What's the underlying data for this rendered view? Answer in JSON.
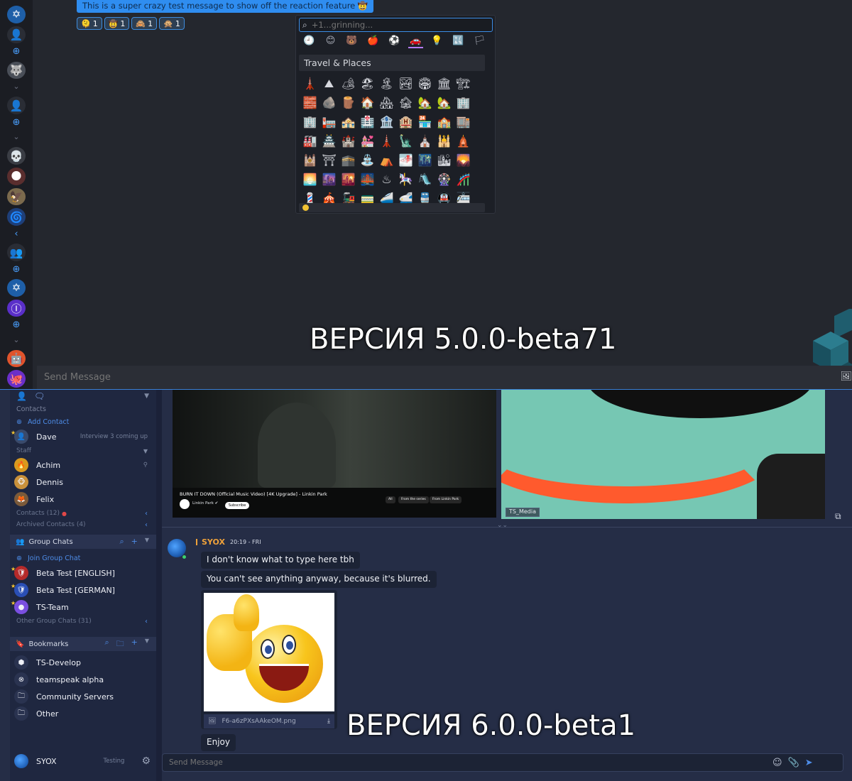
{
  "top": {
    "pinned_message": "This is a super crazy test message to show off the reaction feature 🤠",
    "reactions": [
      {
        "emoji": "🫠",
        "count": "1"
      },
      {
        "emoji": "🤠",
        "count": "1"
      },
      {
        "emoji": "🙈",
        "count": "1"
      },
      {
        "emoji": "🙊",
        "count": "1"
      }
    ],
    "emoji_picker": {
      "search_placeholder": "+1...grinning...",
      "categories": [
        "🕘",
        "😊",
        "🐻",
        "🍎",
        "⚽",
        "🚗",
        "💡",
        "🔣",
        "🏳"
      ],
      "active_category_index": 5,
      "section_title": "Travel & Places",
      "emojis": [
        "🗼",
        "⛰",
        "🏕",
        "🏖",
        "🏝",
        "🏞",
        "🏟",
        "🏛",
        "🏗",
        "🧱",
        "🪨",
        "🪵",
        "🏠",
        "🏘",
        "🏚",
        "🏡",
        "🏡",
        "🏢",
        "🏢",
        "🏣",
        "🏤",
        "🏥",
        "🏦",
        "🏨",
        "🏪",
        "🏫",
        "🏬",
        "🏭",
        "🏯",
        "🏰",
        "💒",
        "🗼",
        "🗽",
        "⛪",
        "🕌",
        "🛕",
        "🕍",
        "⛩",
        "🕋",
        "⛲",
        "⛺",
        "🌁",
        "🌃",
        "🏙",
        "🌄",
        "🌅",
        "🌆",
        "🌇",
        "🌉",
        "♨",
        "🎠",
        "🛝",
        "🎡",
        "🎢",
        "💈",
        "🎪",
        "🚂",
        "🚃",
        "🚄",
        "🚅",
        "🚆",
        "🚇",
        "🚈"
      ]
    },
    "caption": "ВЕРСИЯ 5.0.0-beta71",
    "input_placeholder": "Send Message",
    "rail": [
      {
        "name": "app-logo-icon",
        "glyph": "✡",
        "bg": "#1e5fa8"
      },
      {
        "name": "user-icon",
        "glyph": "👤",
        "bg": "#2a2d35"
      },
      {
        "name": "server-avatar-1",
        "glyph": "🐺",
        "bg": "#4a4f58"
      },
      {
        "name": "user-icon-2",
        "glyph": "👤",
        "bg": "#2a2d35"
      },
      {
        "name": "server-avatar-2",
        "glyph": "💀",
        "bg": "#3a3d44"
      },
      {
        "name": "server-avatar-3",
        "glyph": "🌑",
        "bg": "#5a2e2e"
      },
      {
        "name": "server-avatar-4",
        "glyph": "🦅",
        "bg": "#7b6a4d"
      },
      {
        "name": "server-avatar-5",
        "glyph": "🌀",
        "bg": "#1e3f79"
      },
      {
        "name": "group-icon",
        "glyph": "👥",
        "bg": "#2a2d35"
      },
      {
        "name": "server-avatar-6",
        "glyph": "✡",
        "bg": "#1e5fa8"
      },
      {
        "name": "server-avatar-7",
        "glyph": "Ⓘ",
        "bg": "#5a2fc9"
      },
      {
        "name": "server-avatar-8",
        "glyph": "🤖",
        "bg": "#e0542c"
      },
      {
        "name": "server-avatar-9",
        "glyph": "🐙",
        "bg": "#6b2fc9"
      }
    ]
  },
  "bottom": {
    "sidebar": {
      "contacts_header": "Contacts",
      "add_contact": "Add Contact",
      "contacts": [
        {
          "name": "Dave",
          "status": "Interview 3 coming up",
          "avatar": "👤",
          "bg": "#3a4a6b"
        }
      ],
      "staff_header": "Staff",
      "staff": [
        {
          "name": "Achim",
          "avatar": "🔥",
          "bg": "#d99a1e"
        },
        {
          "name": "Dennis",
          "avatar": "🐵",
          "bg": "#c9913b"
        },
        {
          "name": "Felix",
          "avatar": "🦊",
          "bg": "#7b5a3a"
        }
      ],
      "contacts_collapsed": "Contacts (12)",
      "archived_contacts": "Archived Contacts (4)",
      "group_chats_title": "Group Chats",
      "join_group_chat": "Join Group Chat",
      "groups": [
        {
          "name": "Beta Test [ENGLISH]",
          "avatar": "🛡",
          "bg": "#b52a2a"
        },
        {
          "name": "Beta Test [GERMAN]",
          "avatar": "🛡",
          "bg": "#2a4fb5"
        },
        {
          "name": "TS-Team",
          "avatar": "●",
          "bg": "#7a4fe0"
        }
      ],
      "other_group_chats": "Other Group Chats (31)",
      "bookmarks_title": "Bookmarks",
      "bookmarks": [
        {
          "name": "TS-Develop",
          "avatar": "⬢",
          "bg": "#2a3350"
        },
        {
          "name": "teamspeak alpha",
          "avatar": "⊗",
          "bg": "#2a3350"
        },
        {
          "name": "Community Servers",
          "avatar": "🗀",
          "bg": "#2a3350"
        },
        {
          "name": "Other",
          "avatar": "🗀",
          "bg": "#2a3350"
        }
      ],
      "footer_name": "SYOX",
      "footer_status": "Testing"
    },
    "video_a": {
      "title": "BURN IT DOWN (Official Music Video) [4K Upgrade] - Linkin Park",
      "channel": "Linkin Park ✔",
      "subscribe": "Subscribe",
      "chips": [
        "All",
        "From the series",
        "From Linkin Park"
      ]
    },
    "video_b": {
      "label": "TS_Media"
    },
    "message": {
      "author": "SYOX",
      "time": "20:19 - FRI",
      "lines": [
        "I don't know what to type here tbh",
        "You can't see anything anyway, because it's blurred."
      ],
      "image_filename": "F6-a6zPXsAAkeOM.png",
      "final_line": "Enjoy"
    },
    "caption": "ВЕРСИЯ 6.0.0-beta1",
    "input_placeholder": "Send Message"
  }
}
